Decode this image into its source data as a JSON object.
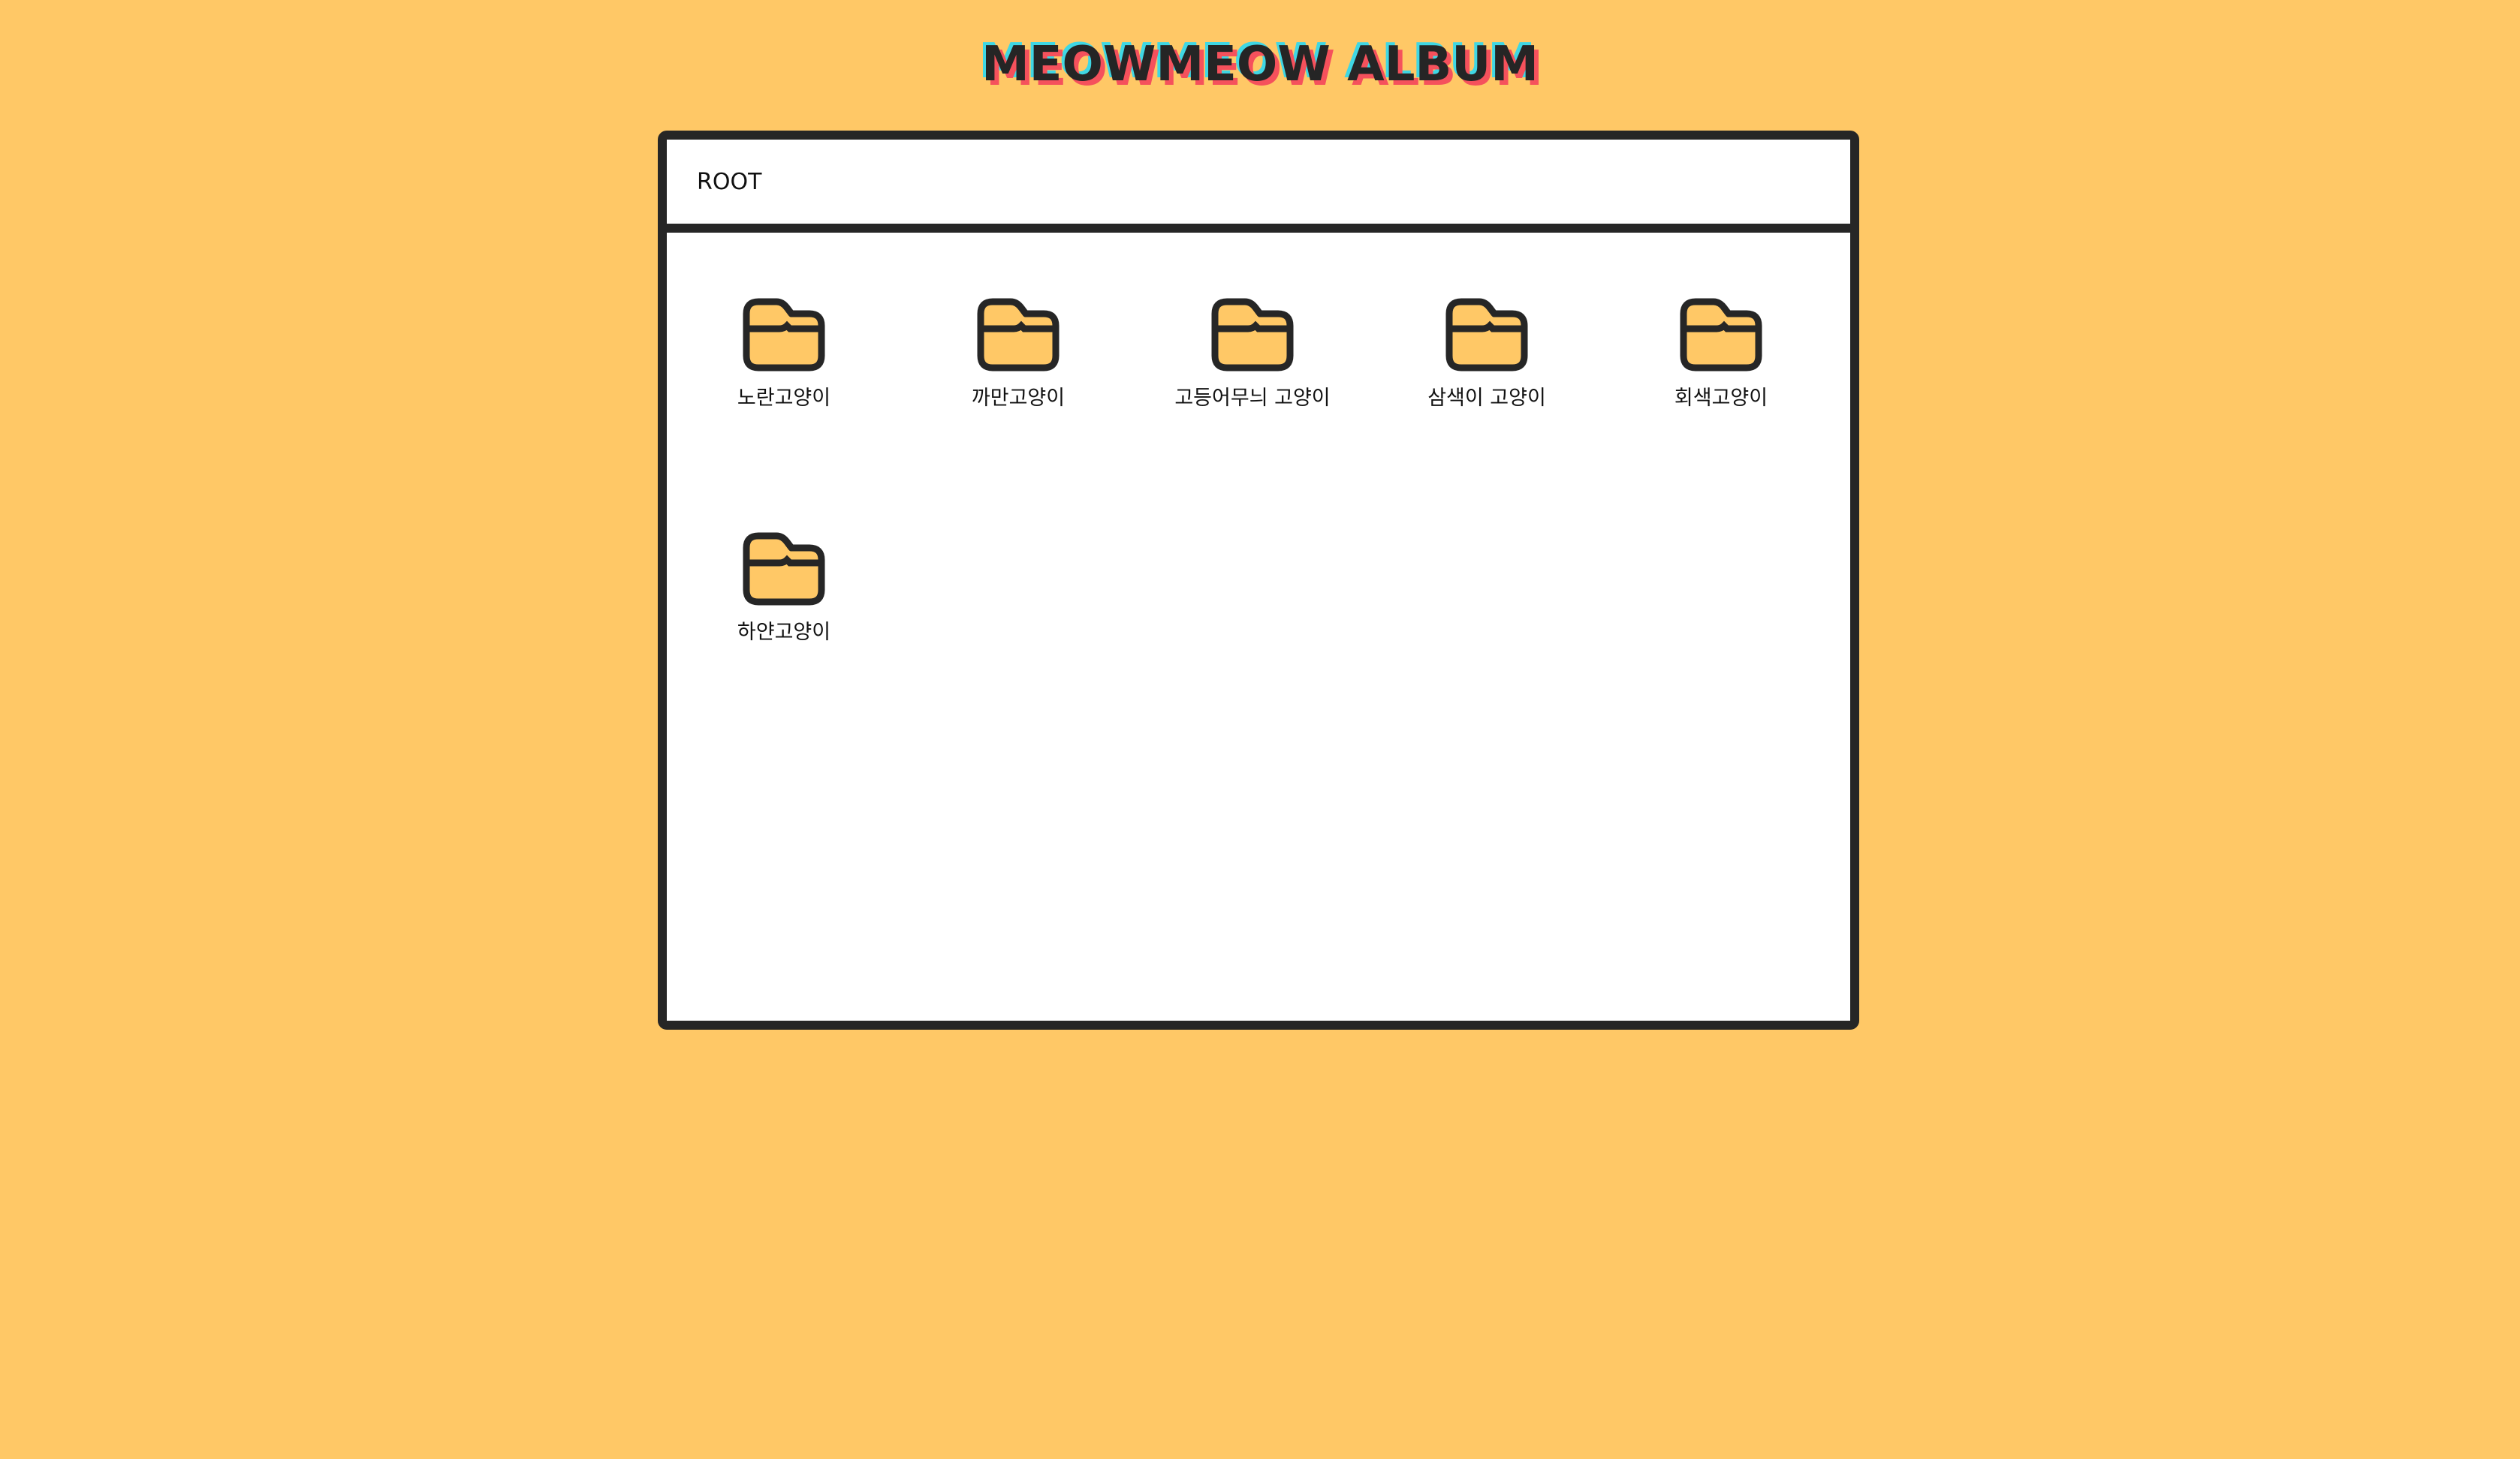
{
  "app": {
    "title": "MEOWMEOW ALBUM"
  },
  "breadcrumb": {
    "items": [
      "ROOT"
    ]
  },
  "nodes": [
    {
      "name": "노란고양이",
      "type": "folder",
      "icon": "folder-icon"
    },
    {
      "name": "까만고양이",
      "type": "folder",
      "icon": "folder-icon"
    },
    {
      "name": "고등어무늬 고양이",
      "type": "folder",
      "icon": "folder-icon"
    },
    {
      "name": "삼색이 고양이",
      "type": "folder",
      "icon": "folder-icon"
    },
    {
      "name": "회색고양이",
      "type": "folder",
      "icon": "folder-icon"
    },
    {
      "name": "하얀고양이",
      "type": "folder",
      "icon": "folder-icon"
    }
  ],
  "colors": {
    "background": "#FFC866",
    "frame": "#262626",
    "folder_fill": "#FFC866",
    "title_shadow_red": "#F5515C",
    "title_shadow_cyan": "#3FD7E4"
  }
}
